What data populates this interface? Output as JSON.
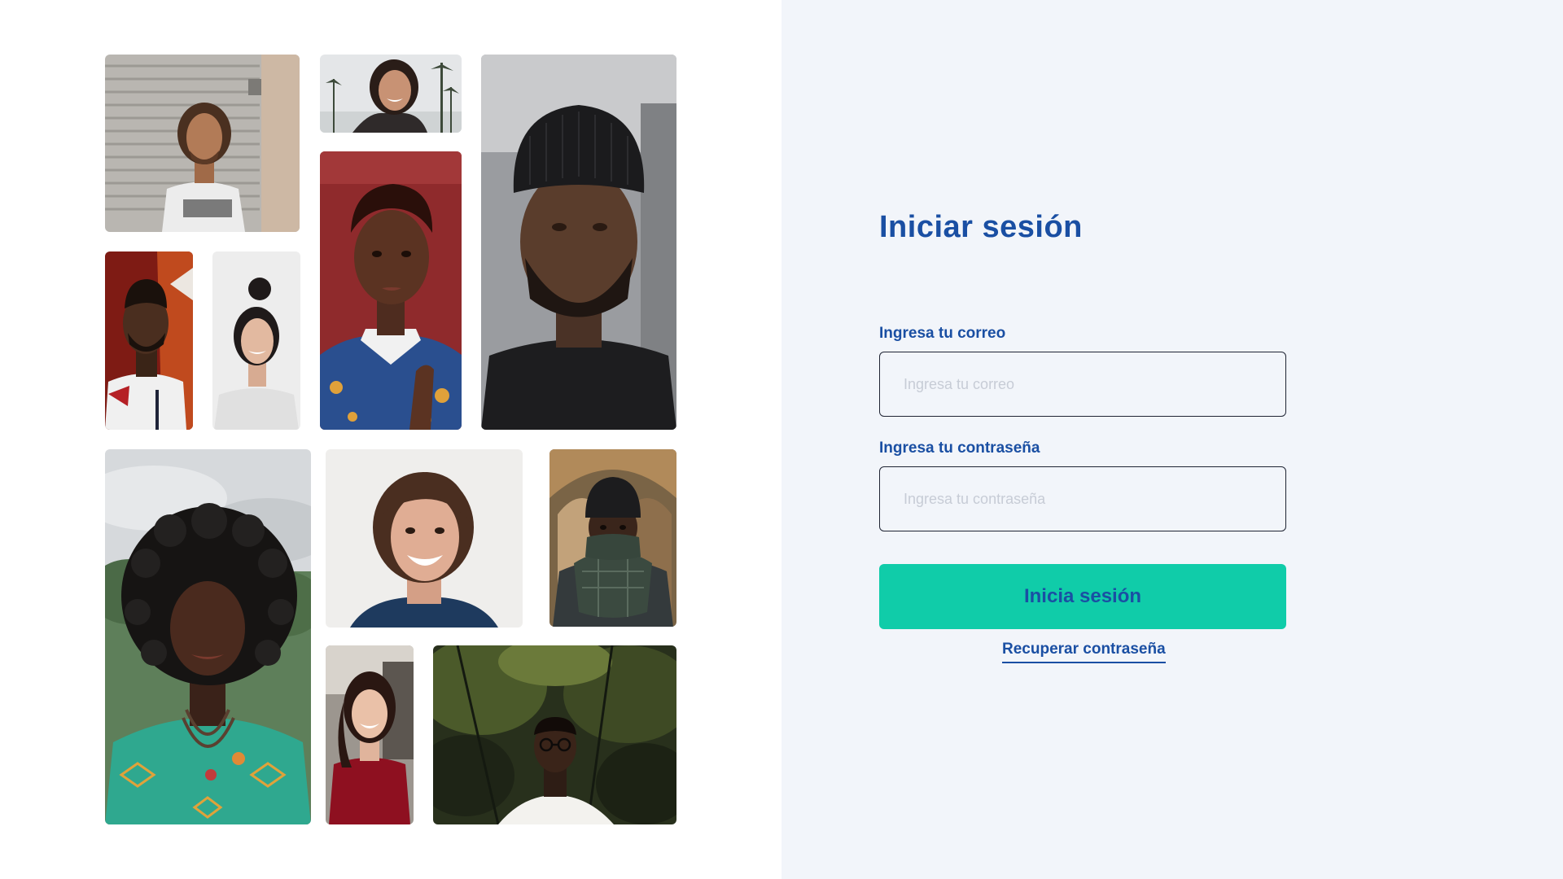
{
  "login": {
    "title": "Iniciar sesión",
    "email_label": "Ingresa tu correo",
    "email_placeholder": "Ingresa tu correo",
    "password_label": "Ingresa tu contraseña",
    "password_placeholder": "Ingresa tu contraseña",
    "submit_label": "Inicia sesión",
    "recover_label": "Recuperar contraseña"
  },
  "colors": {
    "primary": "#1a4fa3",
    "accent": "#10cca9",
    "panel_background": "#f2f5fa"
  },
  "gallery": {
    "photos": [
      "portrait-man-dreadlocks-photo",
      "portrait-woman-laughing-palms-photo",
      "portrait-man-beanie-beard-photo",
      "portrait-woman-short-hair-photo",
      "portrait-man-beard-photo",
      "portrait-woman-bun-photo",
      "portrait-woman-curly-hair-photo",
      "portrait-person-smiling-photo",
      "portrait-man-scarf-photo",
      "portrait-woman-red-sweater-photo",
      "portrait-man-glasses-forest-photo"
    ]
  }
}
